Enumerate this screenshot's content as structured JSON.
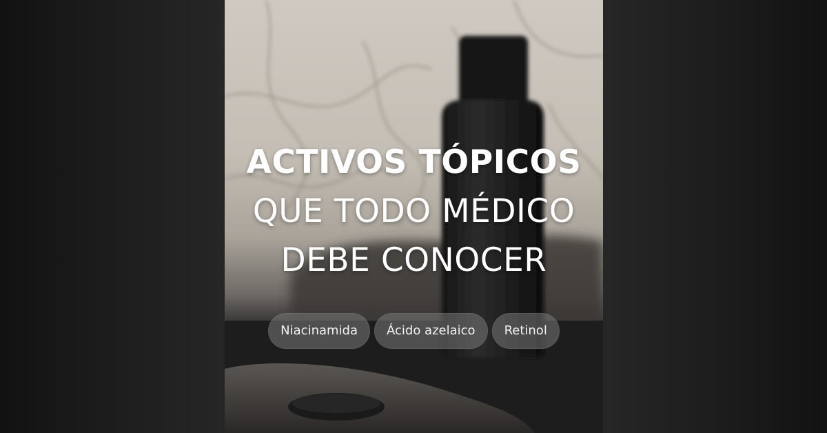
{
  "headline": {
    "line1": "ACTIVOS TÓPICOS",
    "line2": "QUE TODO MÉDICO",
    "line3": "DEBE CONOCER"
  },
  "tags": [
    "Niacinamida",
    "Ácido azelaico",
    "Retinol"
  ],
  "colors": {
    "text": "#ffffff",
    "chip_bg": "#787878",
    "frame_bg": "#1c1c1c"
  }
}
